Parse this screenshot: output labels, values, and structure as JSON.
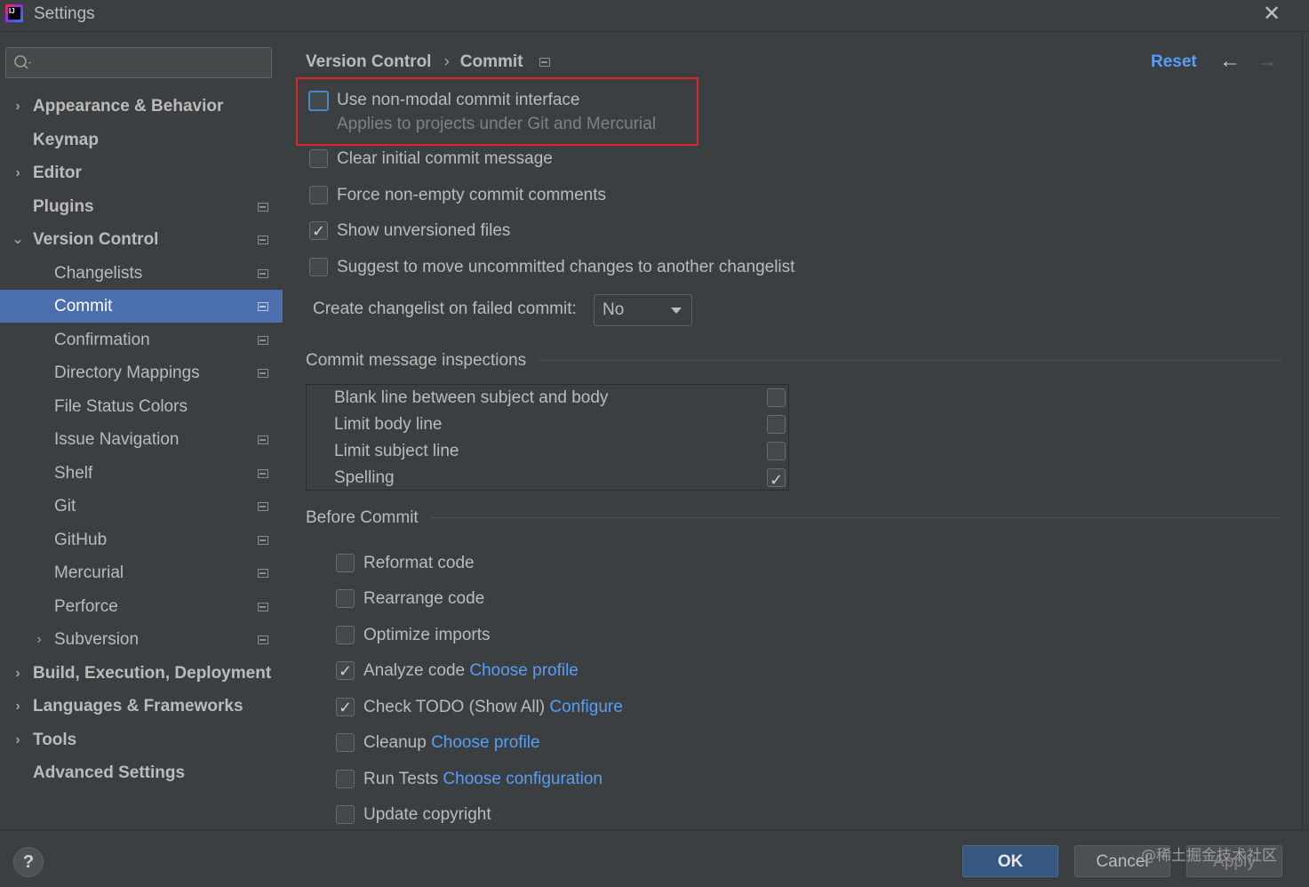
{
  "window": {
    "title": "Settings",
    "close": "✕"
  },
  "sidebar": {
    "search_placeholder": "",
    "items": [
      {
        "label": "Appearance & Behavior",
        "arrow": "›"
      },
      {
        "label": "Keymap"
      },
      {
        "label": "Editor",
        "arrow": "›"
      },
      {
        "label": "Plugins"
      },
      {
        "label": "Version Control",
        "arrow": "⌄"
      },
      {
        "label": "Changelists"
      },
      {
        "label": "Commit"
      },
      {
        "label": "Confirmation"
      },
      {
        "label": "Directory Mappings"
      },
      {
        "label": "File Status Colors"
      },
      {
        "label": "Issue Navigation"
      },
      {
        "label": "Shelf"
      },
      {
        "label": "Git"
      },
      {
        "label": "GitHub"
      },
      {
        "label": "Mercurial"
      },
      {
        "label": "Perforce"
      },
      {
        "label": "Subversion",
        "arrow": "›"
      },
      {
        "label": "Build, Execution, Deployment",
        "arrow": "›"
      },
      {
        "label": "Languages & Frameworks",
        "arrow": "›"
      },
      {
        "label": "Tools",
        "arrow": "›"
      },
      {
        "label": "Advanced Settings"
      }
    ]
  },
  "header": {
    "breadcrumb": [
      "Version Control",
      "›",
      "Commit"
    ],
    "reset": "Reset",
    "back": "←",
    "forward": "→"
  },
  "options": {
    "nonmodal": {
      "label": "Use non-modal commit interface",
      "hint": "Applies to projects under Git and Mercurial",
      "checked": false
    },
    "clear_initial": {
      "label": "Clear initial commit message",
      "checked": false
    },
    "force_nonempty": {
      "label": "Force non-empty commit comments",
      "checked": false
    },
    "show_unversioned": {
      "label": "Show unversioned files",
      "checked": true
    },
    "suggest_move": {
      "label": "Suggest to move uncommitted changes to another changelist",
      "checked": false
    },
    "create_changelist": {
      "label": "Create changelist on failed commit:",
      "value": "No"
    }
  },
  "inspections": {
    "title": "Commit message inspections",
    "rows": [
      {
        "label": "Blank line between subject and body",
        "checked": false
      },
      {
        "label": "Limit body line",
        "checked": false
      },
      {
        "label": "Limit subject line",
        "checked": false
      },
      {
        "label": "Spelling",
        "checked": true
      }
    ]
  },
  "before_commit": {
    "title": "Before Commit",
    "items": [
      {
        "label": "Reformat code",
        "link": "",
        "checked": false
      },
      {
        "label": "Rearrange code",
        "link": "",
        "checked": false
      },
      {
        "label": "Optimize imports",
        "link": "",
        "checked": false
      },
      {
        "label": "Analyze code",
        "link": "Choose profile",
        "checked": true
      },
      {
        "label": "Check TODO (Show All)",
        "link": "Configure",
        "checked": true
      },
      {
        "label": "Cleanup",
        "link": "Choose profile",
        "checked": false
      },
      {
        "label": "Run Tests",
        "link": "Choose configuration",
        "checked": false
      },
      {
        "label": "Update copyright",
        "link": "",
        "checked": false
      }
    ]
  },
  "footer": {
    "help": "?",
    "ok": "OK",
    "cancel": "Cancel",
    "apply": "Apply",
    "watermark": "@稀土掘金技术社区"
  },
  "colors": {
    "accent": "#4b6eaf",
    "link": "#589df6",
    "highlight": "#e0242b",
    "background": "#3c3f41"
  }
}
